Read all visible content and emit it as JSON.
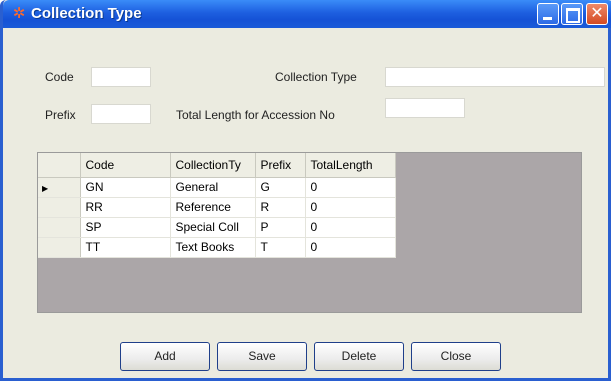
{
  "window": {
    "title": "Collection Type",
    "title_icon": "app-icon"
  },
  "form": {
    "code_label": "Code",
    "code_value": "",
    "prefix_label": "Prefix",
    "prefix_value": "",
    "collection_type_label": "Collection Type",
    "collection_type_value": "",
    "total_length_label": "Total Length for Accession No",
    "total_length_value": ""
  },
  "grid": {
    "columns": [
      "Code",
      "CollectionTy",
      "Prefix",
      "TotalLength"
    ],
    "rows": [
      [
        "GN",
        "General",
        "G",
        "0"
      ],
      [
        "RR",
        "Reference",
        "R",
        "0"
      ],
      [
        "SP",
        "Special Coll",
        "P",
        "0"
      ],
      [
        "TT",
        "Text Books",
        "T",
        "0"
      ]
    ],
    "current_row_index": 0
  },
  "buttons": {
    "add": "Add",
    "save": "Save",
    "delete": "Delete",
    "close": "Close"
  },
  "colors": {
    "titlebar": "#1d5fe0",
    "window_bg": "#ebebe0",
    "grid_bg": "#aba6a8"
  }
}
